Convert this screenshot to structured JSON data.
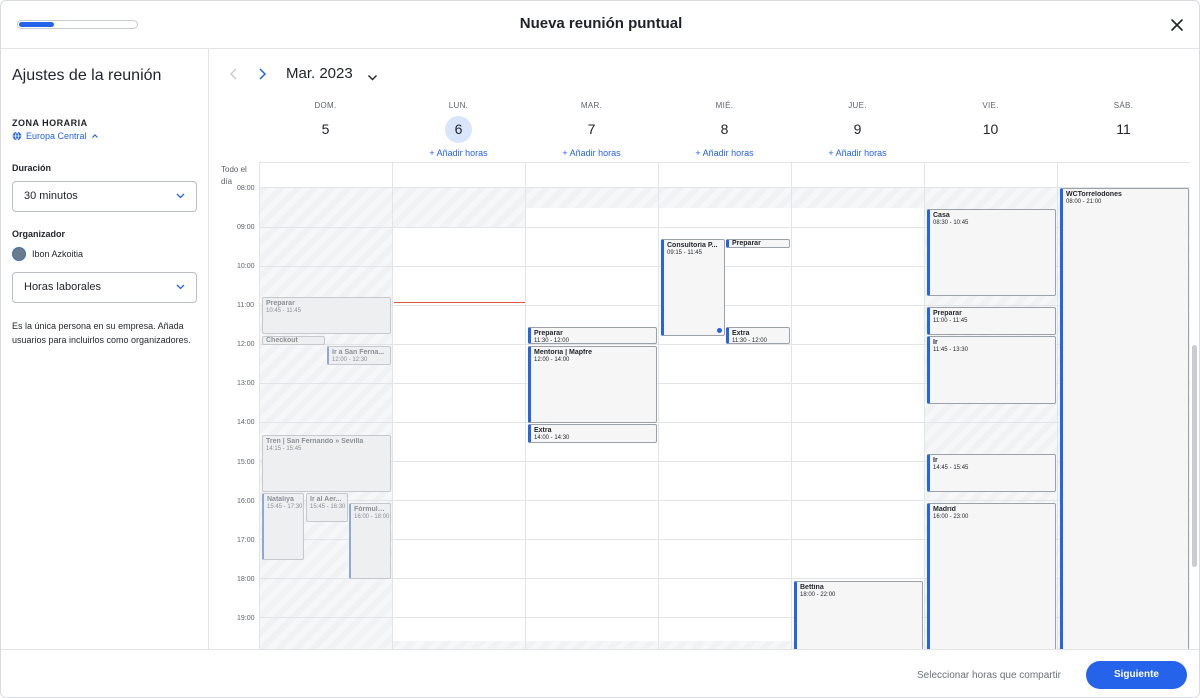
{
  "header": {
    "title": "Nueva reunión puntual",
    "progress": 0.3
  },
  "sidebar": {
    "title": "Ajustes de la reunión",
    "timezone_label": "ZONA HORARIA",
    "timezone_value": "Europa Central",
    "duration_label": "Duración",
    "duration_value": "30 minutos",
    "organizer_label": "Organizador",
    "organizer_name": "Ibon Azkoitia",
    "hours_value": "Horas laborales",
    "note": "Es la única persona en su empresa. Añada usuarios para incluirlos como organizadores."
  },
  "calendar": {
    "month": "Mar. 2023",
    "allday_label": "Todo el día",
    "add_hours": "Añadir horas",
    "days": [
      {
        "dow": "DOM.",
        "num": "5"
      },
      {
        "dow": "LUN.",
        "num": "6"
      },
      {
        "dow": "MAR.",
        "num": "7"
      },
      {
        "dow": "MIÉ.",
        "num": "8"
      },
      {
        "dow": "JUE.",
        "num": "9"
      },
      {
        "dow": "VIE.",
        "num": "10"
      },
      {
        "dow": "SÁB.",
        "num": "11"
      }
    ],
    "times": [
      "08:00",
      "09:00",
      "10:00",
      "11:00",
      "12:00",
      "13:00",
      "14:00",
      "15:00",
      "16:00",
      "17:00",
      "18:00",
      "19:00"
    ],
    "events": [
      {
        "title": "Preparar",
        "time": "10:45 - 11:45"
      },
      {
        "title": "Checkout",
        "time": ""
      },
      {
        "title": "Ir a San Ferna...",
        "time": "12:00 - 12:30"
      },
      {
        "title": "Tren | San Fernando » Sevilla",
        "time": "14:15 - 15:45"
      },
      {
        "title": "Nataliya",
        "time": "15:45 - 17:30"
      },
      {
        "title": "Ir al Aer...",
        "time": "15:45 - 16:30"
      },
      {
        "title": "Fórmula 1",
        "time": "16:00 - 18:00"
      },
      {
        "title": "Preparar",
        "time": "11:30 - 12:00"
      },
      {
        "title": "Mentoria | Mapfre",
        "time": "12:00 - 14:00"
      },
      {
        "title": "Extra",
        "time": "14:00 - 14:30"
      },
      {
        "title": "Consultoría P...",
        "time": "09:15 - 11:45"
      },
      {
        "title": "Preparar",
        "time": ""
      },
      {
        "title": "Extra",
        "time": "11:30 - 12:00"
      },
      {
        "title": "Bettina",
        "time": "18:00 - 22:00"
      },
      {
        "title": "Casa",
        "time": "08:30 - 10:45"
      },
      {
        "title": "Preparar",
        "time": "11:00 - 11:45"
      },
      {
        "title": "Ir",
        "time": "11:45 - 13:30"
      },
      {
        "title": "Ir",
        "time": "14:45 - 15:45"
      },
      {
        "title": "Madrid",
        "time": "16:00 - 23:00"
      },
      {
        "title": "WCTorrelodones",
        "time": "08:00 - 21:00"
      }
    ]
  },
  "footer": {
    "hint": "Seleccionar horas que compartir",
    "next_label": "Siguiente"
  },
  "colors": {
    "accent": "#2563eb",
    "now_line": "#e0533c"
  }
}
